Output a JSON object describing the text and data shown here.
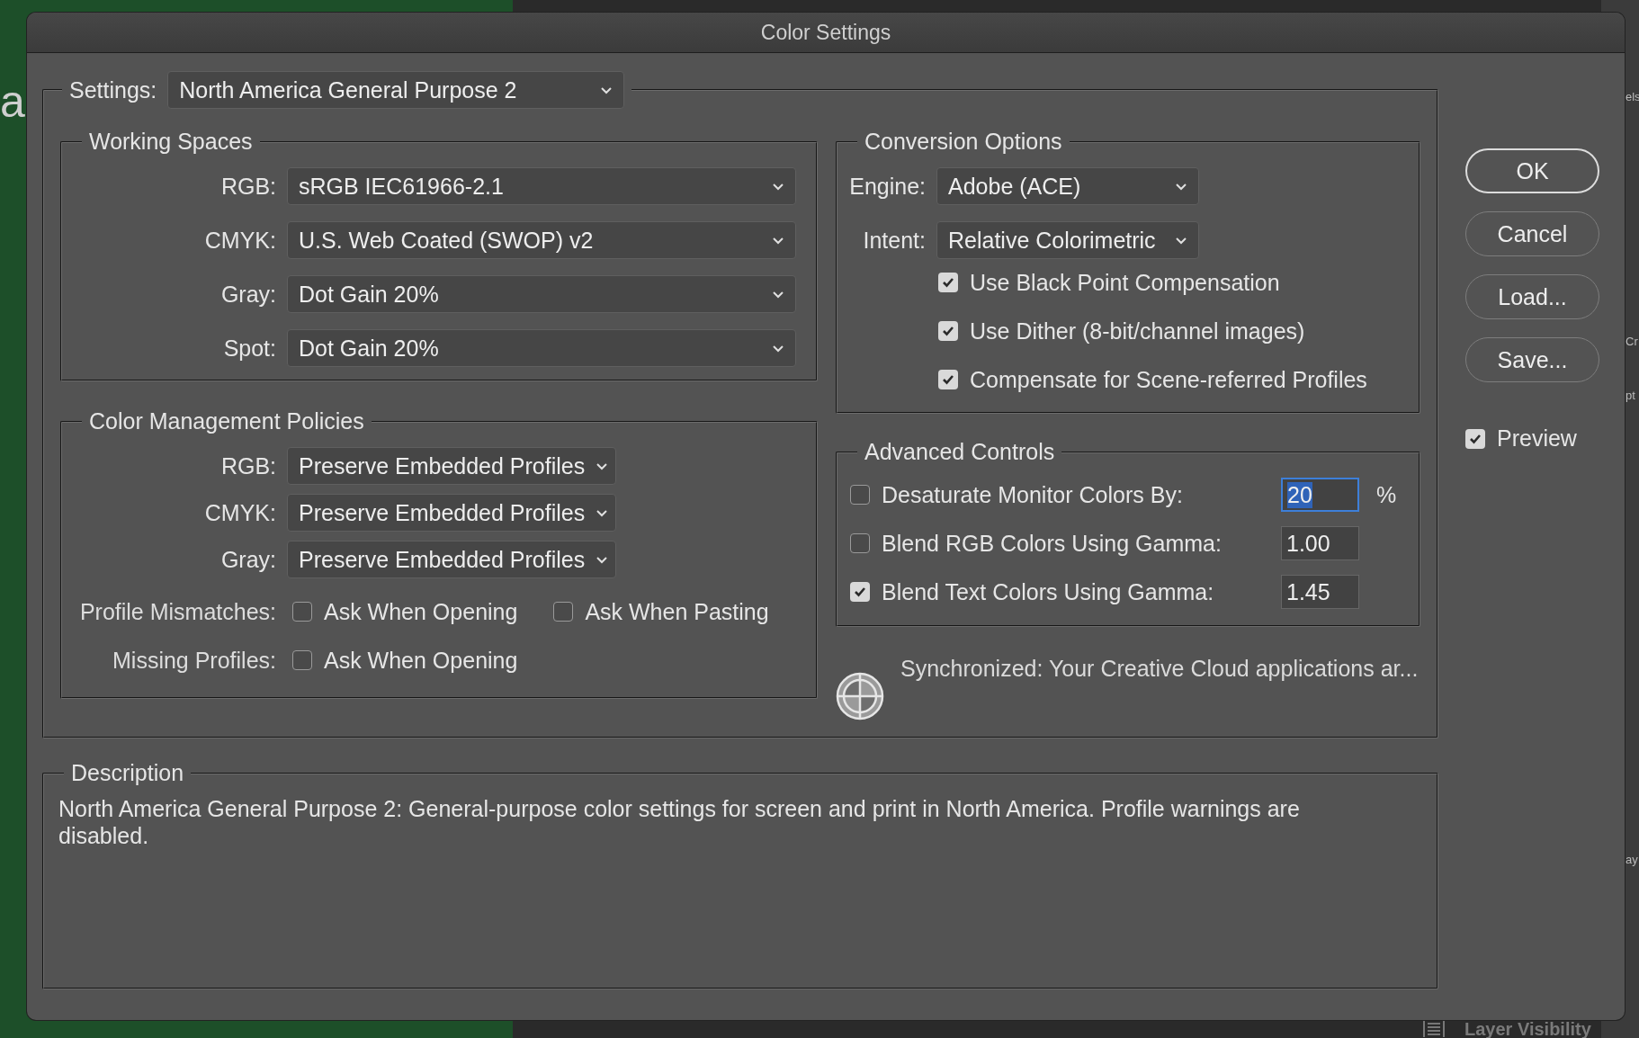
{
  "background": {
    "left_fragment": "a",
    "right_fragments": [
      "els",
      "Cr",
      "pt",
      "ay"
    ],
    "bottom_label": "Layer Visibility"
  },
  "window": {
    "title": "Color Settings"
  },
  "settings": {
    "label": "Settings:",
    "value": "North America General Purpose 2"
  },
  "working_spaces": {
    "title": "Working Spaces",
    "rows": [
      {
        "label": "RGB:",
        "value": "sRGB IEC61966-2.1"
      },
      {
        "label": "CMYK:",
        "value": "U.S. Web Coated (SWOP) v2"
      },
      {
        "label": "Gray:",
        "value": "Dot Gain 20%"
      },
      {
        "label": "Spot:",
        "value": "Dot Gain 20%"
      }
    ]
  },
  "policies": {
    "title": "Color Management Policies",
    "rows": [
      {
        "label": "RGB:",
        "value": "Preserve Embedded Profiles"
      },
      {
        "label": "CMYK:",
        "value": "Preserve Embedded Profiles"
      },
      {
        "label": "Gray:",
        "value": "Preserve Embedded Profiles"
      }
    ],
    "checks": [
      {
        "label": "Profile Mismatches:",
        "options": [
          {
            "label": "Ask When Opening",
            "checked": false
          },
          {
            "label": "Ask When Pasting",
            "checked": false
          }
        ]
      },
      {
        "label": "Missing Profiles:",
        "options": [
          {
            "label": "Ask When Opening",
            "checked": false
          }
        ]
      }
    ]
  },
  "conversion": {
    "title": "Conversion Options",
    "rows": [
      {
        "label": "Engine:",
        "value": "Adobe (ACE)"
      },
      {
        "label": "Intent:",
        "value": "Relative Colorimetric"
      }
    ],
    "options": [
      {
        "label": "Use Black Point Compensation",
        "checked": true
      },
      {
        "label": "Use Dither (8-bit/channel images)",
        "checked": true
      },
      {
        "label": "Compensate for Scene-referred Profiles",
        "checked": true
      }
    ]
  },
  "advanced": {
    "title": "Advanced Controls",
    "rows": [
      {
        "label": "Desaturate Monitor Colors By:",
        "checked": false,
        "value": "20",
        "focused": true,
        "unit": "%"
      },
      {
        "label": "Blend RGB Colors Using Gamma:",
        "checked": false,
        "value": "1.00",
        "focused": false
      },
      {
        "label": "Blend Text Colors Using Gamma:",
        "checked": true,
        "value": "1.45",
        "focused": false
      }
    ]
  },
  "sync": {
    "message": "Synchronized: Your Creative Cloud applications ar..."
  },
  "description": {
    "title": "Description",
    "text": "North America General Purpose 2:  General-purpose color settings for screen and print in North America. Profile warnings are disabled."
  },
  "buttons": [
    {
      "label": "OK",
      "default": true
    },
    {
      "label": "Cancel",
      "default": false
    },
    {
      "label": "Load...",
      "default": false
    },
    {
      "label": "Save...",
      "default": false
    }
  ],
  "preview": {
    "label": "Preview",
    "checked": true
  }
}
